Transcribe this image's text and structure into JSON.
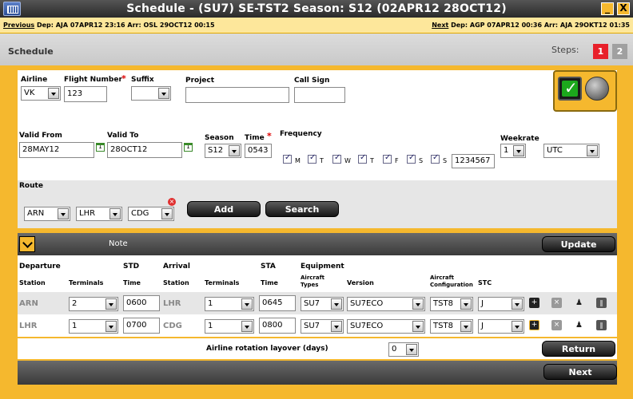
{
  "window": {
    "title": "Schedule - (SU7) SE-TST2 Season: S12 (02APR12 28OCT12)",
    "minimize_label": "_",
    "close_label": "X"
  },
  "nav": {
    "previous_label": "Previous",
    "previous_text": " Dep: AJA 07APR12 23:16 Arr: OSL 29OCT12 00:15",
    "next_label": "Next",
    "next_text": " Dep: AGP 07APR12 00:36 Arr: AJA 29OKT12 01:35"
  },
  "section": {
    "title": "Schedule",
    "steps_label": "Steps:",
    "steps": [
      "1",
      "2"
    ],
    "colors": {
      "active_step": "#e8202a",
      "inactive_step": "#a0a0a0",
      "accent": "#f5b82e"
    }
  },
  "flight": {
    "airline_label": "Airline",
    "airline_value": "VK",
    "flight_number_label": "Flight Number",
    "flight_number_value": "123",
    "required_mark": "*",
    "suffix_label": "Suffix",
    "suffix_value": "",
    "project_label": "Project",
    "project_value": "",
    "call_sign_label": "Call Sign",
    "call_sign_value": ""
  },
  "period": {
    "valid_from_label": "Valid From",
    "valid_from_value": "28MAY12",
    "valid_to_label": "Valid To",
    "valid_to_value": "28OCT12",
    "calendar_glyph": "1",
    "season_label": "Season",
    "season_value": "S12",
    "time_label": "Time",
    "time_value": "0543",
    "frequency_label": "Frequency",
    "days": [
      "M",
      "T",
      "W",
      "T",
      "F",
      "S",
      "S"
    ],
    "frequency_value": "1234567",
    "weekrate_label": "Weekrate",
    "weekrate_value": "1",
    "timezone_value": "UTC"
  },
  "route": {
    "label": "Route",
    "stations": [
      "ARN",
      "LHR",
      "CDG"
    ],
    "add_label": "Add",
    "search_label": "Search"
  },
  "note": {
    "label": "Note",
    "update_label": "Update"
  },
  "table": {
    "groups": {
      "departure": "Departure",
      "std": "STD",
      "arrival": "Arrival",
      "sta": "STA",
      "equipment": "Equipment"
    },
    "columns": {
      "station": "Station",
      "terminals": "Terminals",
      "time": "Time",
      "arr_station": "Station",
      "arr_terminals": "Terminals",
      "arr_time": "Time",
      "aircraft_types_1": "Aircraft",
      "aircraft_types_2": "Types",
      "version": "Version",
      "config_1": "Aircraft",
      "config_2": "Configuration",
      "stc": "STC"
    },
    "rows": [
      {
        "dep": "ARN",
        "dep_term": "2",
        "std": "0600",
        "arr": "LHR",
        "arr_term": "1",
        "sta": "0645",
        "type": "SU7",
        "version": "SU7ECO",
        "config": "TST8",
        "stc": "J"
      },
      {
        "dep": "LHR",
        "dep_term": "1",
        "std": "0700",
        "arr": "CDG",
        "arr_term": "1",
        "sta": "0800",
        "type": "SU7",
        "version": "SU7ECO",
        "config": "TST8",
        "stc": "J"
      }
    ]
  },
  "footer": {
    "layover_label": "Airline rotation layover (days)",
    "layover_value": "0",
    "return_label": "Return",
    "next_label": "Next"
  }
}
